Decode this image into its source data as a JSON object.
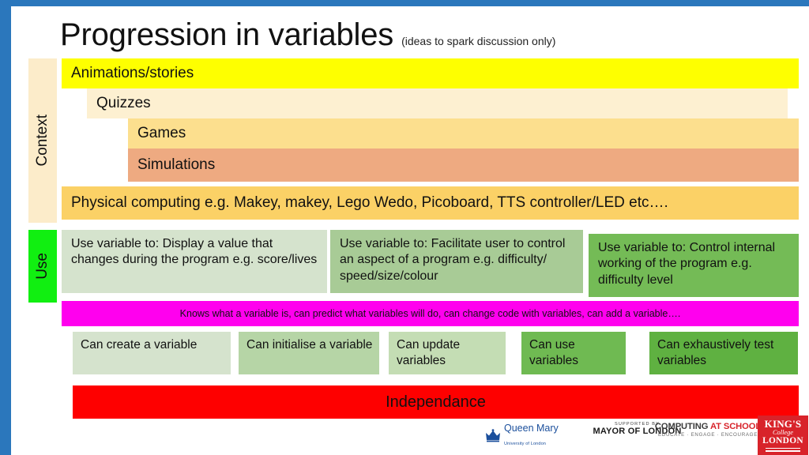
{
  "slide": {
    "title_main": "Progression in variables",
    "title_sub": "(ideas to spark discussion only)"
  },
  "rails": {
    "context_label": "Context",
    "use_label": "Use"
  },
  "context": {
    "bars": [
      {
        "label": "Animations/stories",
        "color": "#feff00"
      },
      {
        "label": "Quizzes",
        "color": "#fdf0d1"
      },
      {
        "label": "Games",
        "color": "#fcdf8e"
      },
      {
        "label": "Simulations",
        "color": "#eeaa81"
      },
      {
        "label": "Physical computing e.g. Makey, makey, Lego Wedo, Picoboard, TTS controller/LED etc….",
        "color": "#fbd166"
      }
    ]
  },
  "use": {
    "boxes": [
      {
        "text": "Use variable to: Display a value that changes during the program e.g. score/lives",
        "color": "#d5e3cd"
      },
      {
        "text": "Use variable to:  Facilitate user to control an aspect  of a program e.g. difficulty/ speed/size/colour",
        "color": "#a8cb96"
      },
      {
        "text": "Use variable to:  Control internal working of the program e.g. difficulty level",
        "color": "#74bb56"
      }
    ]
  },
  "knowledge": {
    "text": "Knows what a variable is, can predict what variables will do, can change code with variables, can add a variable….",
    "color": "#ff00ee"
  },
  "skills": {
    "boxes": [
      {
        "text": "Can create a variable",
        "color": "#d5e3cd"
      },
      {
        "text": "Can initialise a variable",
        "color": "#b6d5a6"
      },
      {
        "text": "Can update variables",
        "color": "#c4ddb4"
      },
      {
        "text": "Can use variables",
        "color": "#6fba52"
      },
      {
        "text": "Can exhaustively test variables",
        "color": "#5fb141"
      }
    ]
  },
  "independence": {
    "label": "Independance",
    "color": "#fe0000"
  },
  "footer": {
    "queen_mary": {
      "name": "Queen Mary",
      "sub": "University of London"
    },
    "mayor": {
      "supported_by": "SUPPORTED BY",
      "name_dark": "MAYOR OF LONDON"
    },
    "cas": {
      "word1": "COMPUTING",
      "word2": "AT SCHOOL",
      "tagline": "EDUCATE · ENGAGE · ENCOURAGE"
    },
    "kcl": {
      "line1": "KING'S",
      "line2": "College",
      "line3": "LONDON"
    }
  }
}
